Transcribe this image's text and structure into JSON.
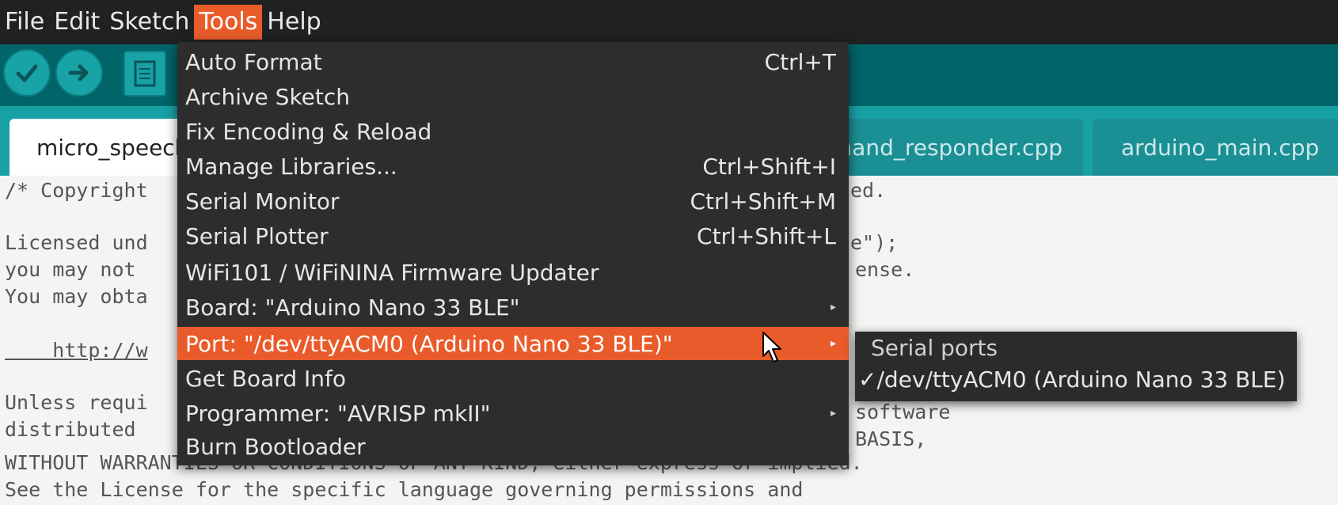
{
  "menubar": {
    "items": [
      "File",
      "Edit",
      "Sketch",
      "Tools",
      "Help"
    ],
    "active": "Tools"
  },
  "toolbar": {
    "verify_icon": "check-icon",
    "upload_icon": "arrow-right-icon",
    "new_icon": "file-icon"
  },
  "tabs": [
    {
      "label": "micro_speech",
      "selected": true
    },
    {
      "label": "command_responder.cpp",
      "selected": false
    },
    {
      "label": "arduino_main.cpp",
      "selected": false
    }
  ],
  "editor": {
    "lines": [
      {
        "left": "/* Copyright",
        "right": "ed."
      },
      {
        "left": "",
        "right": ""
      },
      {
        "left": "Licensed und",
        "right": "e\");"
      },
      {
        "left": "you may not",
        "right": "ense."
      },
      {
        "left": "You may obta",
        "right": ""
      },
      {
        "left": "",
        "right": ""
      },
      {
        "left": "    http://w",
        "right": ""
      },
      {
        "left": "",
        "right": ""
      },
      {
        "left": "Unless requi",
        "right": "software"
      },
      {
        "left": "distributed",
        "right": "BASIS,"
      },
      {
        "left": "WITHOUT WARRANTIES OR CONDITIONS OF ANY KIND, either express or implied.",
        "right": ""
      },
      {
        "left": "See the License for the specific language governing permissions and",
        "right": ""
      }
    ]
  },
  "tools_menu": {
    "items": [
      {
        "label": "Auto Format",
        "shortcut": "Ctrl+T",
        "submenu": false
      },
      {
        "label": "Archive Sketch",
        "shortcut": "",
        "submenu": false
      },
      {
        "label": "Fix Encoding & Reload",
        "shortcut": "",
        "submenu": false
      },
      {
        "label": "Manage Libraries...",
        "shortcut": "Ctrl+Shift+I",
        "submenu": false
      },
      {
        "label": "Serial Monitor",
        "shortcut": "Ctrl+Shift+M",
        "submenu": false
      },
      {
        "label": "Serial Plotter",
        "shortcut": "Ctrl+Shift+L",
        "submenu": false
      },
      {
        "label": "WiFi101 / WiFiNINA Firmware Updater",
        "shortcut": "",
        "submenu": false
      },
      {
        "label": "Board: \"Arduino Nano 33 BLE\"",
        "shortcut": "",
        "submenu": true
      },
      {
        "label": "Port: \"/dev/ttyACM0 (Arduino Nano 33 BLE)\"",
        "shortcut": "",
        "submenu": true,
        "highlighted": true
      },
      {
        "label": "Get Board Info",
        "shortcut": "",
        "submenu": false
      },
      {
        "label": "Programmer: \"AVRISP mkII\"",
        "shortcut": "",
        "submenu": true
      },
      {
        "label": "Burn Bootloader",
        "shortcut": "",
        "submenu": false
      }
    ]
  },
  "port_submenu": {
    "header": "Serial ports",
    "check": "✓",
    "port": "/dev/ttyACM0 (Arduino Nano 33 BLE)"
  },
  "colors": {
    "accent": "#e95b2a",
    "toolbar": "#006468",
    "tabstrip": "#17a1a5",
    "menu_bg": "#2d2d2d"
  }
}
